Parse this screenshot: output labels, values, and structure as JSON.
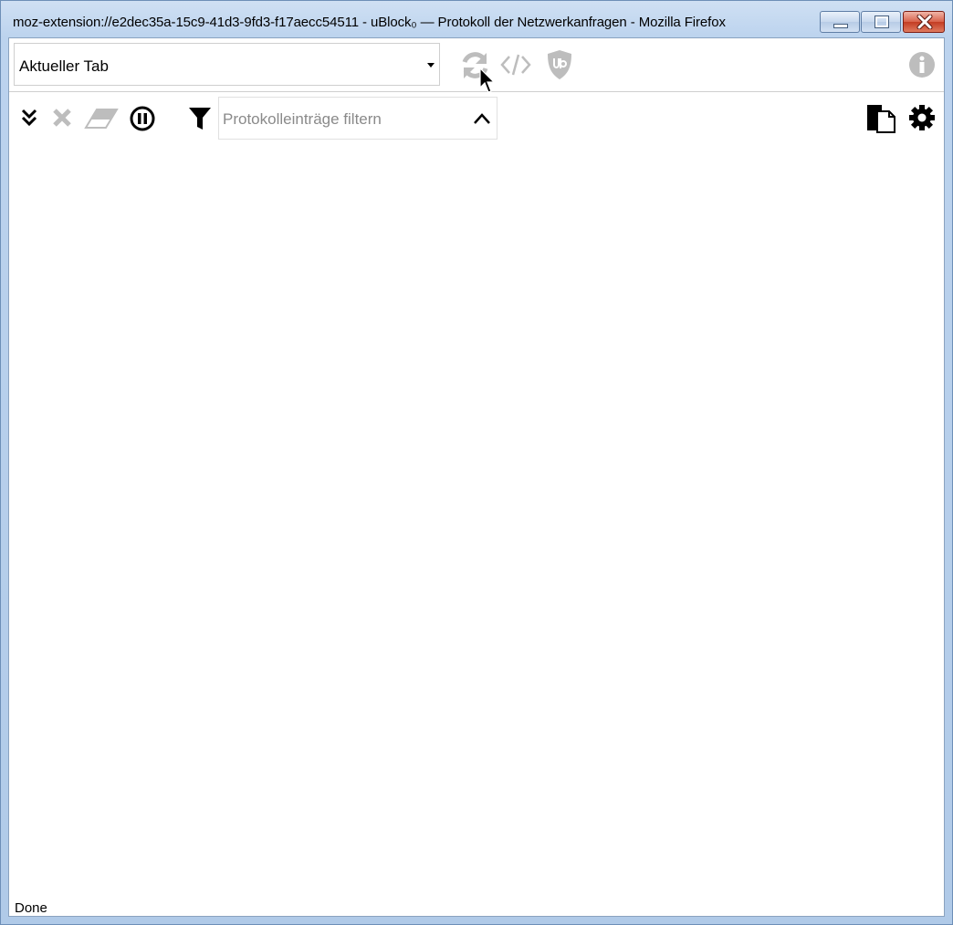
{
  "window": {
    "title": "moz-extension://e2dec35a-15c9-41d3-9fd3-f17aecc54511 - uBlock₀ — Protokoll der Netzwerkanfragen - Mozilla Firefox"
  },
  "toolbar": {
    "tab_selector": {
      "value": "Aktueller Tab"
    },
    "icons": [
      "reload-icon",
      "code-icon",
      "ublock-shield-icon",
      "info-icon"
    ]
  },
  "filterbar": {
    "icons": [
      "expand-all-icon",
      "clear-icon",
      "eraser-icon",
      "pause-icon",
      "filter-icon",
      "chevron-up-icon",
      "copy-icon",
      "gear-icon"
    ],
    "filter_input": {
      "placeholder": "Protokolleinträge filtern",
      "value": ""
    }
  },
  "status": {
    "text": "Done"
  },
  "colors": {
    "disabled_icon": "#bdbdbd",
    "enabled_icon": "#000000"
  }
}
